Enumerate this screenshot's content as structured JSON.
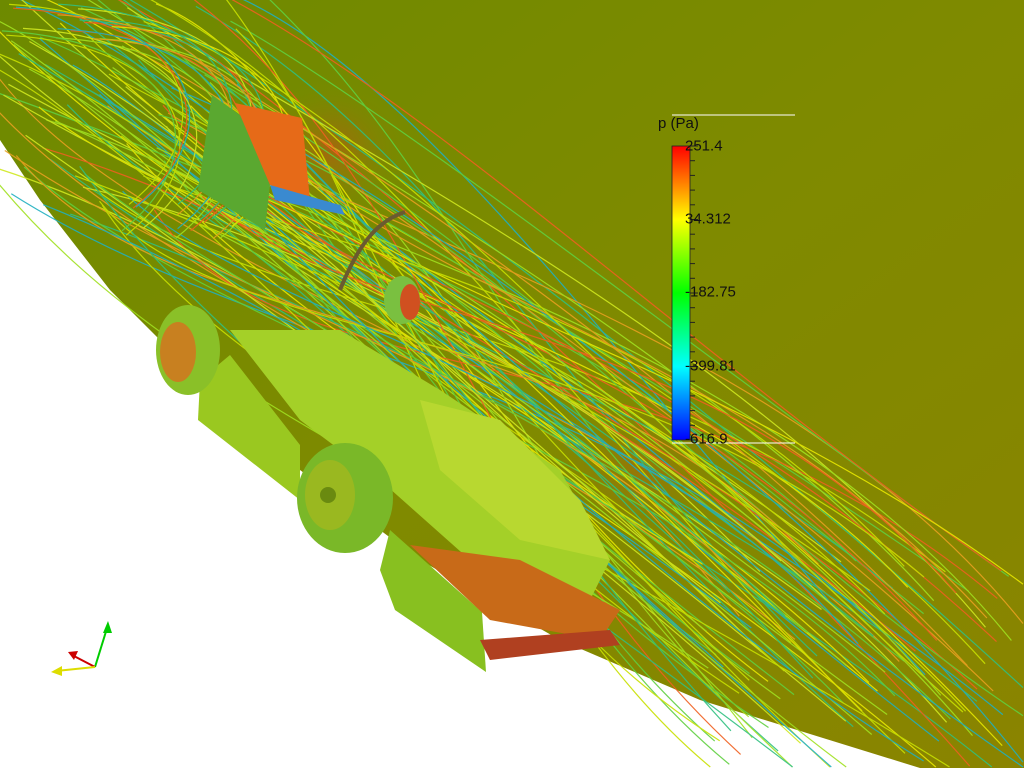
{
  "scalar_bar": {
    "title": "p (Pa)",
    "labels": [
      "251.4",
      "34.312",
      "-182.75",
      "-399.81",
      "-616.9"
    ],
    "range": [
      -616.9,
      251.4
    ],
    "colormap": "rainbow (blue-to-red)",
    "colors": {
      "low": "#0000ff",
      "mid": "#00ff00",
      "high": "#ff0000"
    }
  },
  "scene": {
    "subject": "race car with pressure-colored surface and streamlines",
    "background_field_color": "#7f8c00",
    "ground_color": "#ffffff"
  },
  "orientation_axes": {
    "x_color": "#cc0000",
    "y_color": "#dddd00",
    "z_color": "#00cc00"
  }
}
